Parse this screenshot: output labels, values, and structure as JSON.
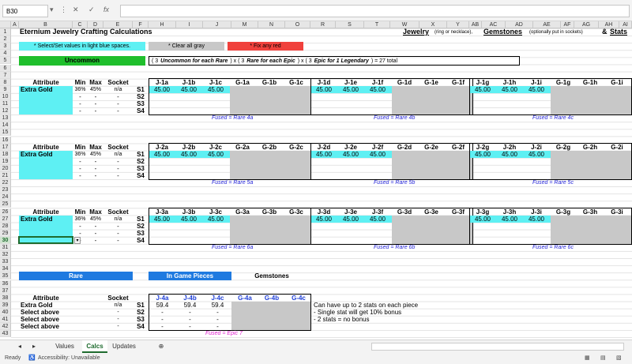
{
  "formula_bar": {
    "name_box": "B30",
    "fx": "fx"
  },
  "columns": [
    "A",
    "B",
    "C",
    "D",
    "E",
    "F",
    "H",
    "I",
    "J",
    "M",
    "N",
    "O",
    "R",
    "S",
    "T",
    "W",
    "X",
    "Y",
    "AB",
    "AC",
    "AD",
    "AE",
    "AF",
    "AG",
    "AH",
    "AI"
  ],
  "rows": [
    "1",
    "2",
    "3",
    "4",
    "5",
    "6",
    "7",
    "8",
    "9",
    "10",
    "11",
    "12",
    "13",
    "14",
    "15",
    "16",
    "17",
    "18",
    "19",
    "20",
    "21",
    "22",
    "23",
    "24",
    "25",
    "26",
    "27",
    "28",
    "29",
    "30",
    "31",
    "32",
    "33",
    "34",
    "35",
    "36",
    "37",
    "38",
    "39",
    "40",
    "41",
    "42",
    "43"
  ],
  "title": "Eternium Jewelry Crafting Calculations",
  "header_right": {
    "jewelry": "Jewelry",
    "jewelry_note": "(ring or necklace),",
    "gemstones": "Gemstones",
    "gemstones_note": "(optionally put in sockets)",
    "amp": "&",
    "stats": "Stats"
  },
  "legend": {
    "cyan": "* Select/Set values in light blue spaces.",
    "gray": "* Clear all gray",
    "red": "* Fix any red"
  },
  "uncommon_label": "Uncommon",
  "formula_text": {
    "a": "( 3",
    "b": "Uncommon for each Rare",
    "c": ") x ( 3",
    "d": "Rare for each Epic",
    "e": ") x ( 3",
    "f": "Epic for 1 Legendary",
    "g": ") = 27 total"
  },
  "attr_headers": {
    "attribute": "Attribute",
    "min": "Min",
    "max": "Max",
    "socket": "Socket"
  },
  "blocks": [
    {
      "row": "9",
      "attribute": "Extra Gold",
      "min": "36%",
      "max": "45%",
      "socket": "n/a",
      "sockets": [
        "S1",
        "S2",
        "S3",
        "S4"
      ],
      "groups": [
        {
          "j": [
            "J-1a",
            "J-1b",
            "J-1c"
          ],
          "g": [
            "G-1a",
            "G-1b",
            "G-1c"
          ],
          "vals": [
            "45.00",
            "45.00",
            "45.00"
          ],
          "fused": "Fused = Rare 4a"
        },
        {
          "j": [
            "J-1d",
            "J-1e",
            "J-1f"
          ],
          "g": [
            "G-1d",
            "G-1e",
            "G-1f"
          ],
          "vals": [
            "45.00",
            "45.00",
            "45.00"
          ],
          "fused": "Fused = Rare 4b"
        },
        {
          "j": [
            "J-1g",
            "J-1h",
            "J-1i"
          ],
          "g": [
            "G-1g",
            "G-1h",
            "G-1i"
          ],
          "vals": [
            "45.00",
            "45.00",
            "45.00"
          ],
          "fused": "Fused = Rare 4c"
        }
      ]
    },
    {
      "row": "18",
      "attribute": "Extra Gold",
      "min": "36%",
      "max": "45%",
      "socket": "n/a",
      "sockets": [
        "S1",
        "S2",
        "S3",
        "S4"
      ],
      "groups": [
        {
          "j": [
            "J-2a",
            "J-2b",
            "J-2c"
          ],
          "g": [
            "G-2a",
            "G-2b",
            "G-2c"
          ],
          "vals": [
            "45.00",
            "45.00",
            "45.00"
          ],
          "fused": "Fused = Rare 5a"
        },
        {
          "j": [
            "J-2d",
            "J-2e",
            "J-2f"
          ],
          "g": [
            "G-2d",
            "G-2e",
            "G-2f"
          ],
          "vals": [
            "45.00",
            "45.00",
            "45.00"
          ],
          "fused": "Fused = Rare 5b"
        },
        {
          "j": [
            "J-2g",
            "J-2h",
            "J-2i"
          ],
          "g": [
            "G-2g",
            "G-2h",
            "G-2i"
          ],
          "vals": [
            "45.00",
            "45.00",
            "45.00"
          ],
          "fused": "Fused = Rare 5c"
        }
      ]
    },
    {
      "row": "27",
      "attribute": "Extra Gold",
      "min": "36%",
      "max": "45%",
      "socket": "n/a",
      "sockets": [
        "S1",
        "S2",
        "S3",
        "S4"
      ],
      "groups": [
        {
          "j": [
            "J-3a",
            "J-3b",
            "J-3c"
          ],
          "g": [
            "G-3a",
            "G-3b",
            "G-3c"
          ],
          "vals": [
            "45.00",
            "45.00",
            "45.00"
          ],
          "fused": "Fused = Rare 6a"
        },
        {
          "j": [
            "J-3d",
            "J-3e",
            "J-3f"
          ],
          "g": [
            "G-3d",
            "G-3e",
            "G-3f"
          ],
          "vals": [
            "45.00",
            "45.00",
            "45.00"
          ],
          "fused": "Fused = Rare 6b"
        },
        {
          "j": [
            "J-3g",
            "J-3h",
            "J-3i"
          ],
          "g": [
            "G-3g",
            "G-3h",
            "G-3i"
          ],
          "vals": [
            "45.00",
            "45.00",
            "45.00"
          ],
          "fused": "Fused = Rare 6c"
        }
      ]
    }
  ],
  "dash": "-",
  "rare": {
    "label": "Rare",
    "in_game": "In Game Pieces",
    "gemstones": "Gemstones",
    "attribute": "Attribute",
    "socket": "Socket",
    "j": [
      "J-4a",
      "J-4b",
      "J-4c"
    ],
    "g": [
      "G-4a",
      "G-4b",
      "G-4c"
    ],
    "rows": [
      {
        "attr": "Extra Gold",
        "socket": "n/a",
        "s": "S1",
        "vals": [
          "59.4",
          "59.4",
          "59.4"
        ]
      },
      {
        "attr": "Select above",
        "socket": "-",
        "s": "S2",
        "vals": [
          "-",
          "-",
          "-"
        ]
      },
      {
        "attr": "Select above",
        "socket": "-",
        "s": "S3",
        "vals": [
          "-",
          "-",
          "-"
        ]
      },
      {
        "attr": "Select above",
        "socket": "-",
        "s": "S4",
        "vals": [
          "-",
          "-",
          "-"
        ]
      }
    ],
    "fused": "Fused = Epic 7"
  },
  "notes": [
    "Can have up to 2 stats on each piece",
    "- Single stat will get 10% bonus",
    "- 2 stats = no bonus"
  ],
  "tabs": [
    "Values",
    "Calcs",
    "Updates"
  ],
  "status": {
    "ready": "Ready",
    "accessibility": "Accessibility: Unavailable"
  },
  "colors": {
    "cyan": "#5ef0f3",
    "gray": "#c8c8c8",
    "red": "#f0413c",
    "green": "#1fbf2c",
    "blue": "#1f7ae0",
    "accent": "#1e6b2e"
  }
}
